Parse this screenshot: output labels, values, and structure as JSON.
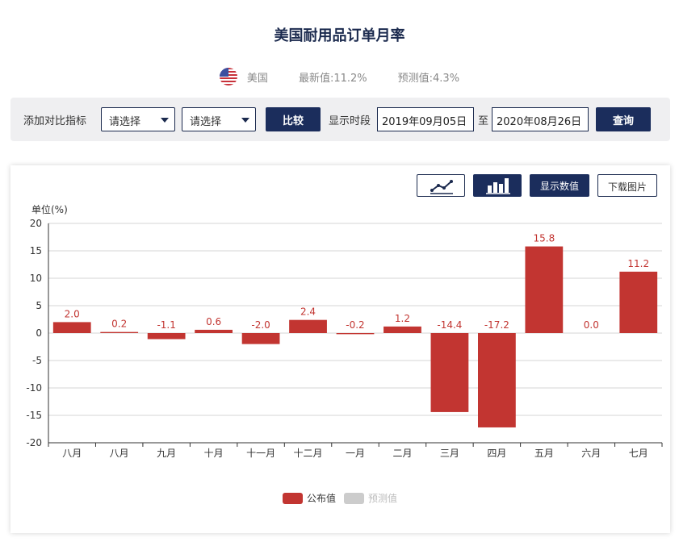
{
  "title": "美国耐用品订单月率",
  "meta": {
    "country": "美国",
    "latest_label": "最新值:",
    "latest_value": "11.2%",
    "forecast_label": "预测值:",
    "forecast_value": "4.3%"
  },
  "toolbar": {
    "compare_label": "添加对比指标",
    "select1_value": "请选择",
    "select2_value": "请选择",
    "compare_button": "比较",
    "period_label": "显示时段",
    "start_date": "2019年09月05日",
    "to_label": "至",
    "end_date": "2020年08月26日",
    "query_button": "查询"
  },
  "card": {
    "line_chart_icon": "line-chart-icon",
    "bar_chart_icon": "bar-chart-icon",
    "show_values_button": "显示数值",
    "download_button": "下载图片"
  },
  "chart_data": {
    "type": "bar",
    "ylabel": "单位(%)",
    "ylim": [
      -20,
      20
    ],
    "yticks": [
      20,
      15,
      10,
      5,
      0,
      -5,
      -10,
      -15,
      -20
    ],
    "categories": [
      "八月",
      "八月",
      "九月",
      "十月",
      "十一月",
      "十二月",
      "一月",
      "二月",
      "三月",
      "四月",
      "五月",
      "六月",
      "七月"
    ],
    "series": [
      {
        "name": "公布值",
        "values": [
          2.0,
          0.2,
          -1.1,
          0.6,
          -2.0,
          2.4,
          -0.2,
          1.2,
          -14.4,
          -17.2,
          15.8,
          0.0,
          11.2
        ],
        "color": "#c23531"
      },
      {
        "name": "预测值",
        "values": [],
        "color": "#cccccc"
      }
    ],
    "data_labels": [
      "2.0",
      "0.2",
      "-1.1",
      "0.6",
      "-2.0",
      "2.4",
      "-0.2",
      "1.2",
      "-14.4",
      "-17.2",
      "15.8",
      "0.0",
      "11.2"
    ],
    "grid": true,
    "legend_position": "bottom-center"
  }
}
